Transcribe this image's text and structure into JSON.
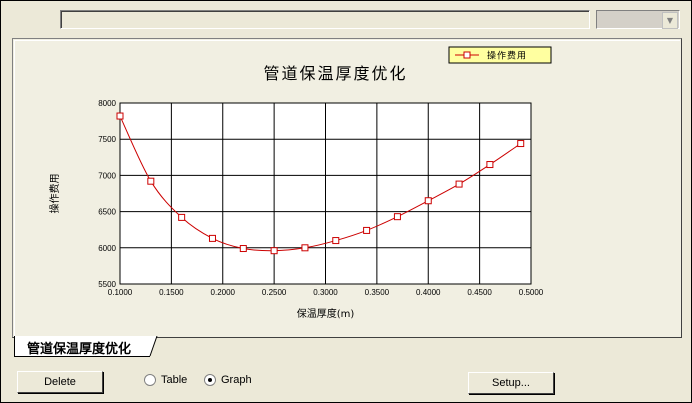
{
  "tab": {
    "label": "管道保温厚度优化"
  },
  "buttons": {
    "delete": "Delete",
    "setup": "Setup..."
  },
  "view_options": [
    {
      "label": "Table",
      "selected": false
    },
    {
      "label": "Graph",
      "selected": true
    }
  ],
  "chart_data": {
    "type": "line",
    "title": "管道保温厚度优化",
    "xlabel": "保温厚度(m)",
    "ylabel": "操作费用",
    "xlim": [
      0.1,
      0.5
    ],
    "ylim": [
      5500,
      8000
    ],
    "x_ticks": [
      "0.1000",
      "0.1500",
      "0.2000",
      "0.2500",
      "0.3000",
      "0.3500",
      "0.4000",
      "0.4500",
      "0.5000"
    ],
    "y_ticks": [
      "5500",
      "6000",
      "6500",
      "7000",
      "7500",
      "8000"
    ],
    "grid": true,
    "legend": "top-right",
    "color": "#cc0000",
    "series": [
      {
        "name": "操作费用",
        "x": [
          0.1,
          0.13,
          0.16,
          0.19,
          0.22,
          0.25,
          0.28,
          0.31,
          0.34,
          0.37,
          0.4,
          0.43,
          0.46,
          0.49
        ],
        "values": [
          7820,
          6920,
          6420,
          6130,
          5990,
          5960,
          6000,
          6100,
          6240,
          6430,
          6650,
          6880,
          7150,
          7440
        ]
      }
    ]
  }
}
